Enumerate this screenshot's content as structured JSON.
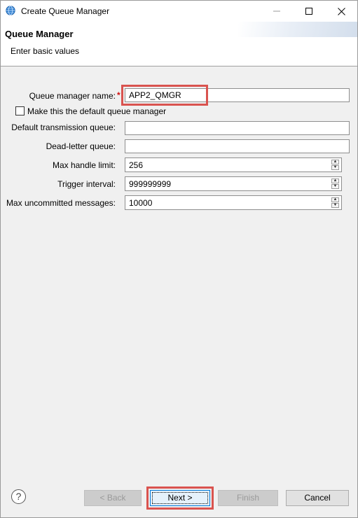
{
  "window": {
    "title": "Create Queue Manager"
  },
  "header": {
    "title": "Queue Manager",
    "description": "Enter basic values"
  },
  "form": {
    "qm_name": {
      "label": "Queue manager name:",
      "required_marker": "*",
      "value": "APP2_QMGR"
    },
    "default_qm_checkbox": {
      "label": "Make this the default queue manager",
      "checked": false
    },
    "default_transmission_queue": {
      "label": "Default transmission queue:",
      "value": ""
    },
    "dead_letter_queue": {
      "label": "Dead-letter queue:",
      "value": ""
    },
    "max_handle_limit": {
      "label": "Max handle limit:",
      "value": "256"
    },
    "trigger_interval": {
      "label": "Trigger interval:",
      "value": "999999999"
    },
    "max_uncommitted": {
      "label": "Max uncommitted messages:",
      "value": "10000"
    }
  },
  "buttons": {
    "back": "< Back",
    "next": "Next >",
    "finish": "Finish",
    "cancel": "Cancel"
  },
  "icons": {
    "app": "globe-icon",
    "help": "help-icon",
    "minimize": "minimize-icon",
    "maximize": "maximize-icon",
    "close": "close-icon"
  },
  "colors": {
    "required": "#d01010",
    "highlight": "#d9534f"
  }
}
